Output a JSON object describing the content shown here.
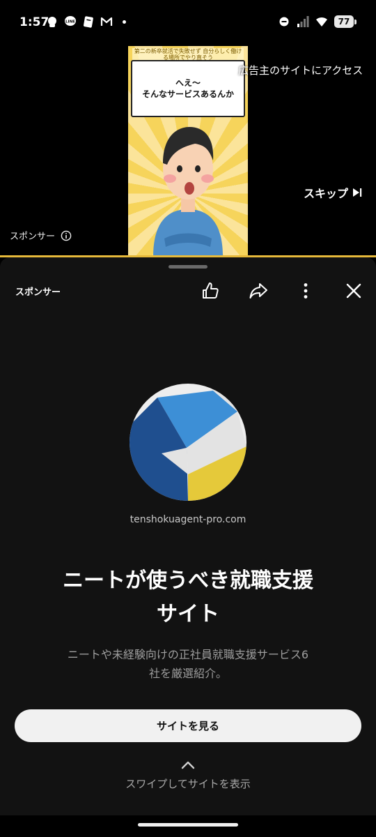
{
  "status_bar": {
    "time": "1:57",
    "battery": "77",
    "left_icons": [
      "threads-icon",
      "line-icon",
      "notes-icon",
      "gmail-icon"
    ],
    "right_icons": [
      "dnd-icon",
      "signal-icon",
      "wifi-icon",
      "battery-icon"
    ]
  },
  "ad": {
    "thumbnail_caption": "第二の新卒就活で失敗せず 自分らしく働ける場所でやり直そう",
    "bubble_line1": "へえ〜",
    "bubble_line2": "そんなサービスあるんか",
    "advertiser_link": "広告主のサイトにアクセス",
    "skip_label": "スキップ",
    "sponsor_label": "スポンサー"
  },
  "sheet": {
    "sponsor_label": "スポンサー",
    "actions": [
      "like-icon",
      "share-icon",
      "more-icon",
      "close-icon"
    ],
    "domain": "tenshokuagent-pro.com",
    "headline_line1": "ニートが使うべき就職支援",
    "headline_line2": "サイト",
    "description_line1": "ニートや未経験向けの正社員就職支援サービス6",
    "description_line2": "社を厳選紹介。",
    "cta_label": "サイトを見る",
    "swipe_hint": "スワイプしてサイトを表示"
  },
  "colors": {
    "background": "#000000",
    "sheet_bg": "#121212",
    "progress": "#e6b93a",
    "logo_dark_blue": "#1f4f8f",
    "logo_light_blue": "#3d8fd6",
    "logo_yellow": "#e5c93a",
    "logo_gray": "#e3e3e3"
  }
}
